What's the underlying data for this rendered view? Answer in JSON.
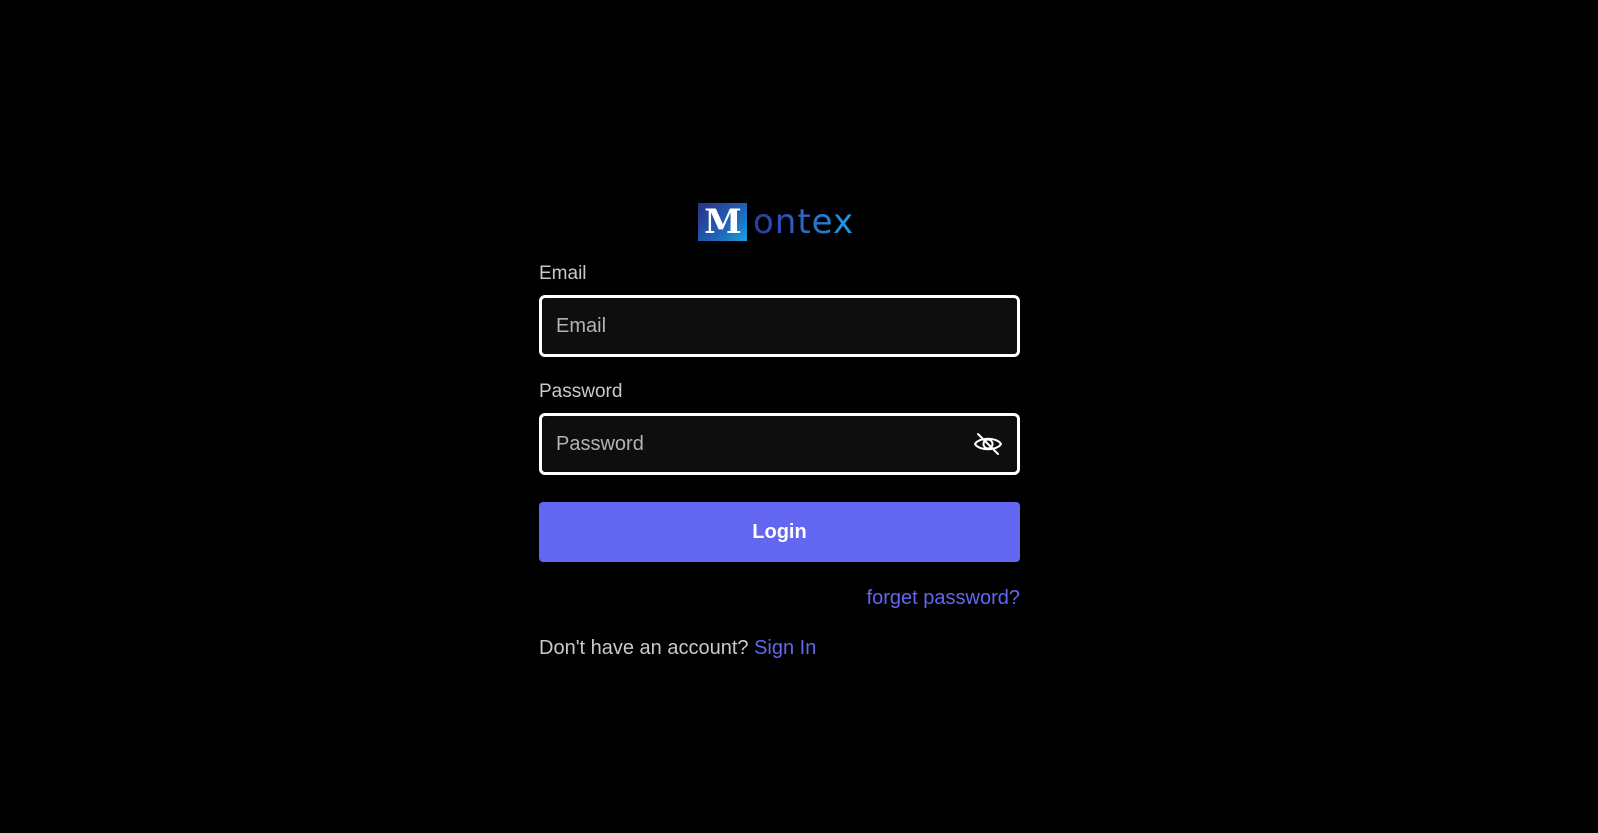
{
  "logo": {
    "mark_letter": "M",
    "text": "ontex"
  },
  "form": {
    "email": {
      "label": "Email",
      "placeholder": "Email",
      "value": ""
    },
    "password": {
      "label": "Password",
      "placeholder": "Password",
      "value": "",
      "toggle_icon": "eye-slash-icon"
    },
    "login_label": "Login",
    "forgot_label": "forget password?",
    "signup_prompt": "Don't have an account?",
    "signup_link": "Sign In"
  },
  "colors": {
    "background": "#000000",
    "accent": "#6366f1",
    "input_border": "#ffffff",
    "input_background": "#0e0e0e",
    "label_text": "#c9c9c9"
  }
}
